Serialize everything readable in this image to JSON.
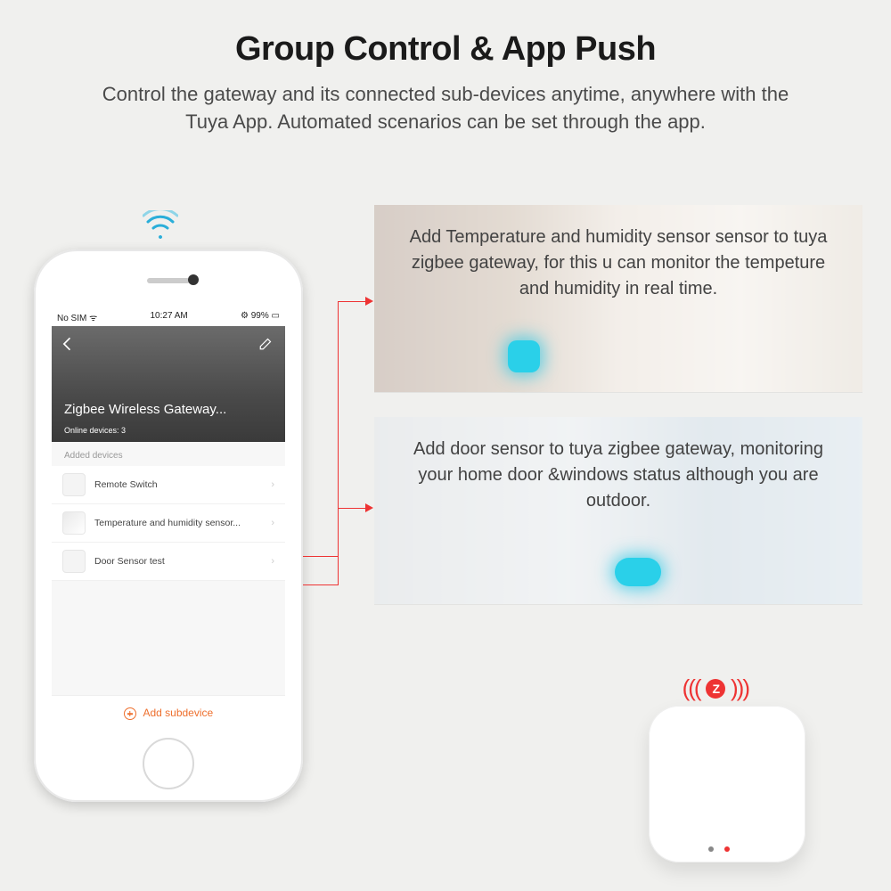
{
  "header": {
    "title": "Group Control  & App Push",
    "description": "Control the gateway and its connected sub-devices anytime, anywhere with the Tuya App. Automated scenarios can be set through the app."
  },
  "phone": {
    "status": {
      "carrier": "No SIM",
      "time": "10:27 AM",
      "battery": "99%"
    },
    "hero": {
      "title": "Zigbee Wireless Gateway...",
      "subtitle": "Online devices: 3"
    },
    "section_label": "Added devices",
    "devices": [
      {
        "name": "Remote Switch"
      },
      {
        "name": "Temperature and humidity sensor..."
      },
      {
        "name": "Door Sensor test"
      }
    ],
    "add_label": "Add subdevice"
  },
  "panels": [
    {
      "text": "Add Temperature and humidity sensor sensor to tuya zigbee gateway, for this u can monitor the tempeture and humidity in real time."
    },
    {
      "text": "Add door sensor to tuya zigbee gateway, monitoring your home door &windows status although you are outdoor."
    }
  ]
}
